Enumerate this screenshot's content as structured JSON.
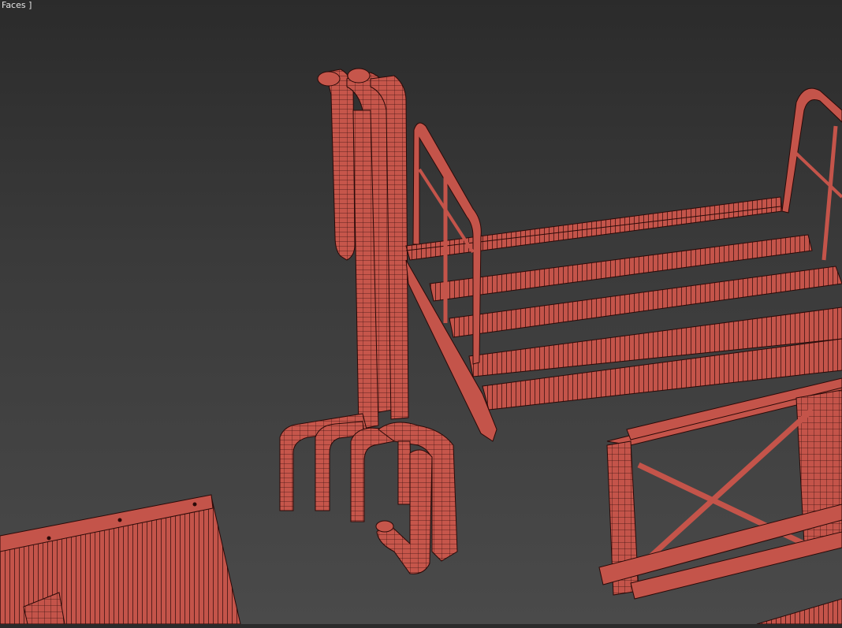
{
  "viewport": {
    "label": "Faces ]",
    "mesh_color": "#c8554a",
    "wire_color": "#2a0a08",
    "background_top": "#2b2b2b",
    "background_bottom": "#4a4a4a"
  }
}
